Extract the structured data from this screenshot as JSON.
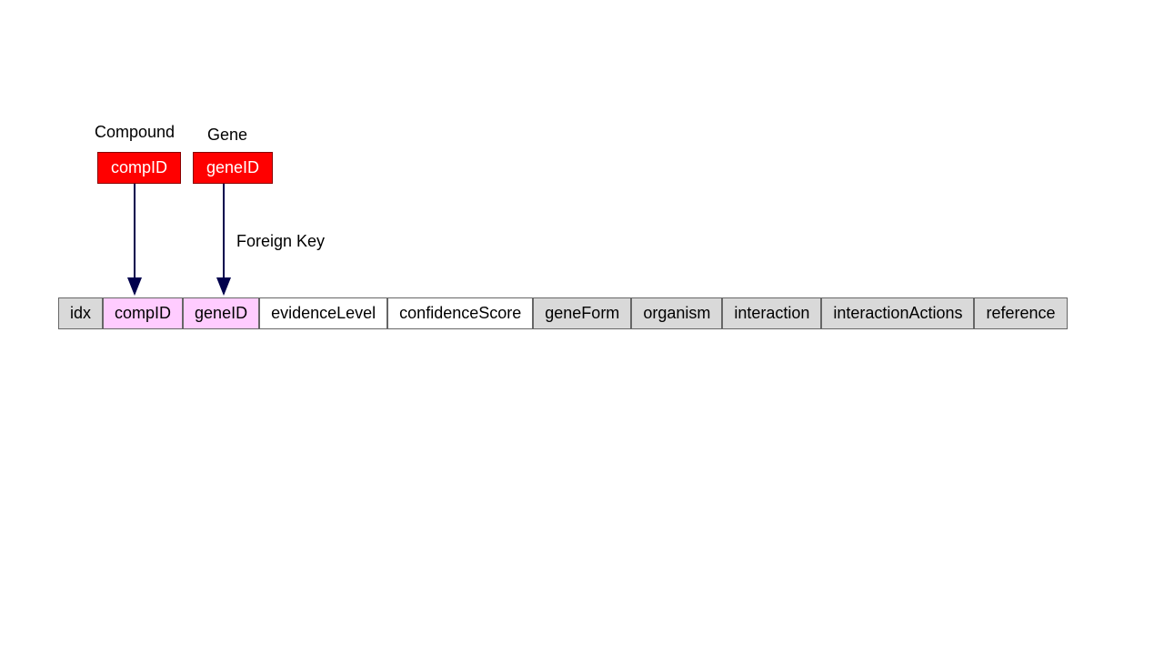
{
  "entities": {
    "compound": {
      "label": "Compound",
      "key": "compID"
    },
    "gene": {
      "label": "Gene",
      "key": "geneID"
    }
  },
  "relationship": {
    "label": "Foreign Key"
  },
  "schema": {
    "columns": [
      {
        "name": "idx",
        "style": "gray"
      },
      {
        "name": "compID",
        "style": "pink"
      },
      {
        "name": "geneID",
        "style": "pink"
      },
      {
        "name": "evidenceLevel",
        "style": "white"
      },
      {
        "name": "confidenceScore",
        "style": "white"
      },
      {
        "name": "geneForm",
        "style": "gray"
      },
      {
        "name": "organism",
        "style": "gray"
      },
      {
        "name": "interaction",
        "style": "gray"
      },
      {
        "name": "interactionActions",
        "style": "gray"
      },
      {
        "name": "reference",
        "style": "gray"
      }
    ]
  }
}
